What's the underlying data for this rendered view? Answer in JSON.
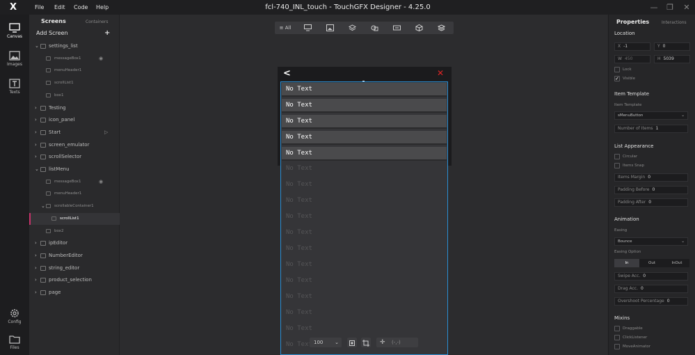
{
  "window": {
    "title": "fcl-740_INL_touch - TouchGFX Designer - 4.25.0",
    "menu": [
      "File",
      "Edit",
      "Code",
      "Help"
    ],
    "logo": "X",
    "controls": {
      "minimize": "—",
      "restore": "❐",
      "close": "✕"
    }
  },
  "rail": {
    "canvas": "Canvas",
    "images": "Images",
    "texts": "Texts",
    "config": "Config",
    "files": "Files"
  },
  "screens_panel": {
    "tab_screens": "Screens",
    "tab_containers": "Containers",
    "add_screen": "Add Screen",
    "add_icon": "+",
    "tree": [
      {
        "label": "settings_list",
        "kind": "screen",
        "expanded": true
      },
      {
        "label": "messageBox1",
        "kind": "widget",
        "eye": true
      },
      {
        "label": "menuHeader1",
        "kind": "widget"
      },
      {
        "label": "scrollList1",
        "kind": "widget"
      },
      {
        "label": "box1",
        "kind": "widget"
      },
      {
        "label": "Testing",
        "kind": "screen"
      },
      {
        "label": "icon_panel",
        "kind": "screen"
      },
      {
        "label": "Start",
        "kind": "screen",
        "start": true
      },
      {
        "label": "screen_emulator",
        "kind": "screen"
      },
      {
        "label": "scrollSelector",
        "kind": "screen"
      },
      {
        "label": "listMenu",
        "kind": "screen",
        "expanded": true
      },
      {
        "label": "messageBox1",
        "kind": "widget",
        "eye": true
      },
      {
        "label": "menuHeader1",
        "kind": "widget"
      },
      {
        "label": "scrollableContainer1",
        "kind": "container"
      },
      {
        "label": "scrollList1",
        "kind": "widget",
        "selected": true
      },
      {
        "label": "box2",
        "kind": "widget"
      },
      {
        "label": "ipEditor",
        "kind": "screen"
      },
      {
        "label": "NumberEditor",
        "kind": "screen"
      },
      {
        "label": "string_editor",
        "kind": "screen"
      },
      {
        "label": "product_selection",
        "kind": "screen"
      },
      {
        "label": "page",
        "kind": "screen"
      }
    ]
  },
  "toolbar": {
    "all_label": "All"
  },
  "canvas": {
    "back_icon": "<",
    "close_icon": "✕",
    "items": [
      "No Text",
      "No Text",
      "No Text",
      "No Text",
      "No Text"
    ],
    "ghost_items": [
      "No Text",
      "No Text",
      "No Text",
      "No Text",
      "No Text",
      "No Text",
      "No Text",
      "No Text",
      "No Text",
      "No Text",
      "No Text",
      "No Text"
    ],
    "zoom_value": "100",
    "coordinate_readout": "(-,-)"
  },
  "properties": {
    "title": "Properties",
    "interactions": "Interactions",
    "location": {
      "heading": "Location",
      "x_label": "X",
      "x_value": "-1",
      "y_label": "Y",
      "y_value": "0",
      "w_label": "W",
      "w_value": "450",
      "h_label": "H",
      "h_value": "5039",
      "lock": "Lock",
      "visible": "Visible"
    },
    "item_template": {
      "heading": "Item Template",
      "label": "Item Template",
      "value": "sMenuButton",
      "number_label": "Number of Items",
      "number_value": "1"
    },
    "list_appearance": {
      "heading": "List Appearance",
      "circular": "Circular",
      "items_snap": "Items Snap",
      "items_margin_label": "Items Margin",
      "items_margin_value": "0",
      "padding_before_label": "Padding Before",
      "padding_before_value": "0",
      "padding_after_label": "Padding After",
      "padding_after_value": "0"
    },
    "animation": {
      "heading": "Animation",
      "easing_label": "Easing",
      "easing_value": "Bounce",
      "easing_option_label": "Easing Option",
      "options": [
        "In",
        "Out",
        "InOut"
      ],
      "swipe_label": "Swipe Acc.",
      "swipe_value": "0",
      "drag_label": "Drag Acc.",
      "drag_value": "0",
      "overshoot_label": "Overshoot Percentage",
      "overshoot_value": "0"
    },
    "mixins": {
      "heading": "Mixins",
      "draggable": "Draggable",
      "click_listener": "ClickListener",
      "move_animator": "MoveAnimator"
    }
  },
  "colors": {
    "accent_selection": "#c8336b",
    "selection_outline": "#2b8fd4",
    "close_red": "#e02424"
  }
}
